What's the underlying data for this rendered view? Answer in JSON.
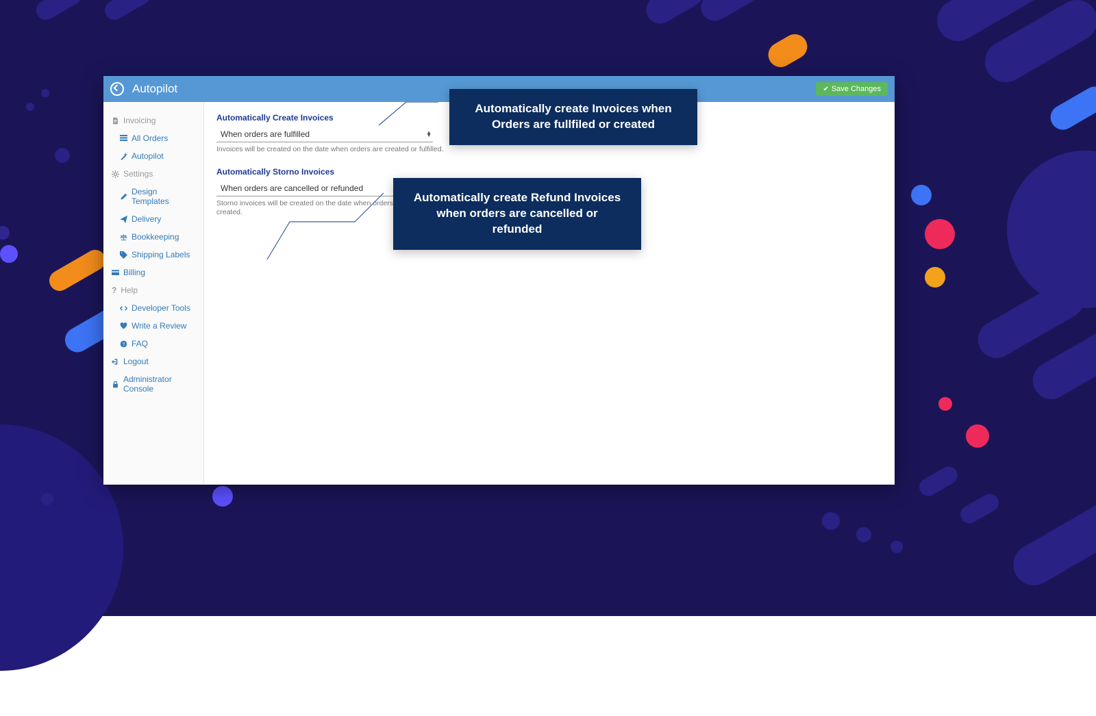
{
  "header": {
    "title": "Autopilot",
    "save_label": "Save Changes"
  },
  "sidebar": {
    "sections": {
      "invoicing": {
        "label": "Invoicing"
      },
      "settings": {
        "label": "Settings"
      },
      "help": {
        "label": "Help"
      }
    },
    "items": {
      "all_orders": "All Orders",
      "autopilot": "Autopilot",
      "design_templates": "Design Templates",
      "delivery": "Delivery",
      "bookkeeping": "Bookkeeping",
      "shipping_labels": "Shipping Labels",
      "billing": "Billing",
      "developer_tools": "Developer Tools",
      "write_review": "Write a Review",
      "faq": "FAQ",
      "logout": "Logout",
      "admin_console": "Administrator Console"
    }
  },
  "form": {
    "auto_create": {
      "title": "Automatically Create Invoices",
      "value": "When orders are fulfilled",
      "helper": "Invoices will be created on the date when orders are created or fulfilled."
    },
    "auto_storno": {
      "title": "Automatically Storno Invoices",
      "value": "When orders are cancelled or refunded",
      "helper": "Storno invoices will be created on the date when orders are voided/cancelled or refunds are created."
    }
  },
  "callouts": {
    "c1": "Automatically create Invoices when Orders are fullfiled or created",
    "c2": "Automatically create Refund Invoices when orders are cancelled or refunded"
  }
}
